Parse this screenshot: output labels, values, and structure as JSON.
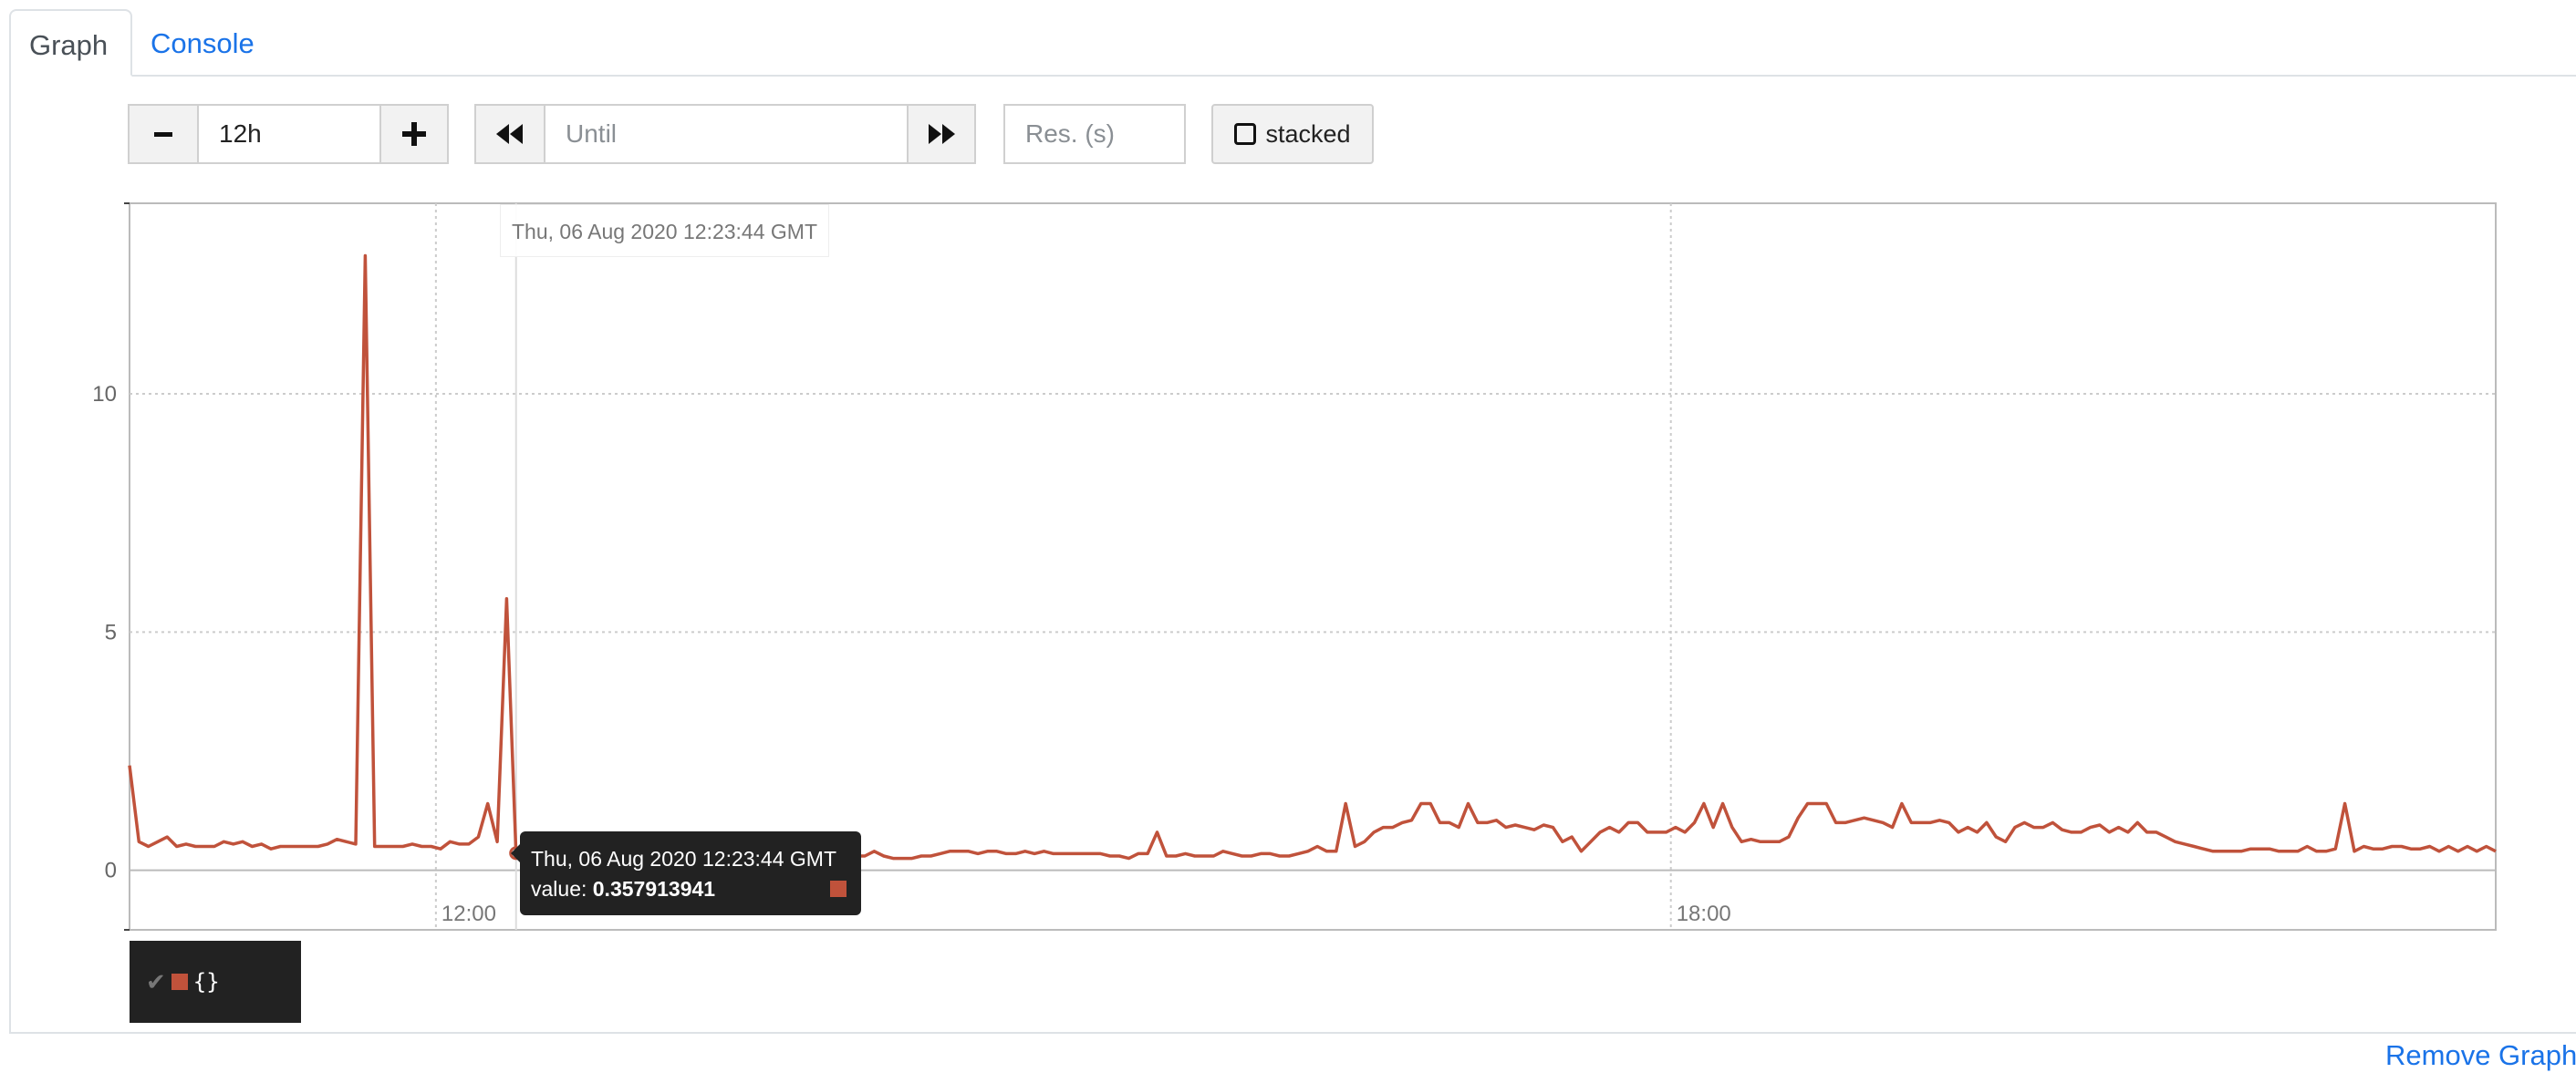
{
  "tabs": [
    {
      "label": "Graph",
      "active": true
    },
    {
      "label": "Console",
      "active": false
    }
  ],
  "controls": {
    "range_minus": "−",
    "range_value": "12h",
    "range_plus": "+",
    "back_icon": "rewind-icon",
    "until_placeholder": "Until",
    "forward_icon": "fast-forward-icon",
    "resolution_placeholder": "Res. (s)",
    "stacked_label": "stacked"
  },
  "hover": {
    "flag_time": "Thu, 06 Aug 2020 12:23:44 GMT",
    "tooltip_time": "Thu, 06 Aug 2020 12:23:44 GMT",
    "tooltip_value_prefix": "value: ",
    "tooltip_value": "0.357913941"
  },
  "legend": {
    "check": "✔",
    "label": "{}"
  },
  "remove_graph_label": "Remove Graph",
  "colors": {
    "series": "#c0523b",
    "link": "#1a73e8"
  },
  "chart_data": {
    "type": "line",
    "x_unit": "time (UTC)",
    "ylim": [
      -1.25,
      14
    ],
    "y_ticks": [
      0,
      5,
      10
    ],
    "y_tick_labels": [
      "0",
      "5",
      "10"
    ],
    "x_tick_labels": [
      "12:00",
      "18:00"
    ],
    "grid": true,
    "legend_position": "bottom-left",
    "series": [
      {
        "name": "{}",
        "color": "#c0523b",
        "values": [
          2.2,
          0.6,
          0.5,
          0.6,
          0.7,
          0.5,
          0.55,
          0.5,
          0.5,
          0.5,
          0.6,
          0.55,
          0.6,
          0.5,
          0.55,
          0.45,
          0.5,
          0.5,
          0.5,
          0.5,
          0.5,
          0.55,
          0.65,
          0.6,
          0.55,
          12.9,
          0.5,
          0.5,
          0.5,
          0.5,
          0.55,
          0.5,
          0.5,
          0.45,
          0.6,
          0.55,
          0.55,
          0.7,
          1.4,
          0.6,
          5.7,
          0.36,
          0.3,
          0.3,
          0.3,
          0.3,
          0.3,
          0.3,
          0.3,
          0.3,
          0.3,
          0.3,
          0.3,
          0.3,
          0.3,
          0.3,
          0.3,
          0.3,
          0.3,
          0.3,
          0.3,
          0.3,
          0.3,
          0.3,
          0.3,
          0.3,
          0.3,
          0.3,
          0.25,
          0.25,
          0.25,
          0.25,
          0.3,
          0.3,
          0.3,
          0.25,
          0.25,
          0.3,
          0.3,
          0.4,
          0.3,
          0.25,
          0.25,
          0.25,
          0.3,
          0.3,
          0.35,
          0.4,
          0.4,
          0.4,
          0.35,
          0.4,
          0.4,
          0.35,
          0.35,
          0.4,
          0.35,
          0.4,
          0.35,
          0.35,
          0.35,
          0.35,
          0.35,
          0.35,
          0.3,
          0.3,
          0.25,
          0.35,
          0.35,
          0.8,
          0.3,
          0.3,
          0.35,
          0.3,
          0.3,
          0.3,
          0.4,
          0.35,
          0.3,
          0.3,
          0.35,
          0.35,
          0.3,
          0.3,
          0.35,
          0.4,
          0.5,
          0.4,
          0.4,
          1.4,
          0.5,
          0.6,
          0.8,
          0.9,
          0.9,
          1.0,
          1.05,
          1.4,
          1.4,
          1.0,
          1.0,
          0.9,
          1.4,
          1.0,
          1.0,
          1.05,
          0.9,
          0.95,
          0.9,
          0.85,
          0.95,
          0.9,
          0.6,
          0.7,
          0.4,
          0.6,
          0.8,
          0.9,
          0.8,
          1.0,
          1.0,
          0.8,
          0.8,
          0.8,
          0.9,
          0.8,
          1.0,
          1.4,
          0.9,
          1.4,
          0.9,
          0.6,
          0.65,
          0.6,
          0.6,
          0.6,
          0.7,
          1.1,
          1.4,
          1.4,
          1.4,
          1.0,
          1.0,
          1.05,
          1.1,
          1.05,
          1.0,
          0.9,
          1.4,
          1.0,
          1.0,
          1.0,
          1.05,
          1.0,
          0.8,
          0.9,
          0.8,
          1.0,
          0.7,
          0.6,
          0.9,
          1.0,
          0.9,
          0.9,
          1.0,
          0.85,
          0.8,
          0.8,
          0.9,
          0.95,
          0.8,
          0.9,
          0.8,
          1.0,
          0.8,
          0.8,
          0.7,
          0.6,
          0.55,
          0.5,
          0.45,
          0.4,
          0.4,
          0.4,
          0.4,
          0.45,
          0.45,
          0.45,
          0.4,
          0.4,
          0.4,
          0.5,
          0.4,
          0.4,
          0.45,
          1.4,
          0.4,
          0.5,
          0.45,
          0.45,
          0.5,
          0.5,
          0.45,
          0.45,
          0.5,
          0.4,
          0.5,
          0.4,
          0.5,
          0.4,
          0.5,
          0.4
        ]
      }
    ],
    "hover_index": 41
  }
}
